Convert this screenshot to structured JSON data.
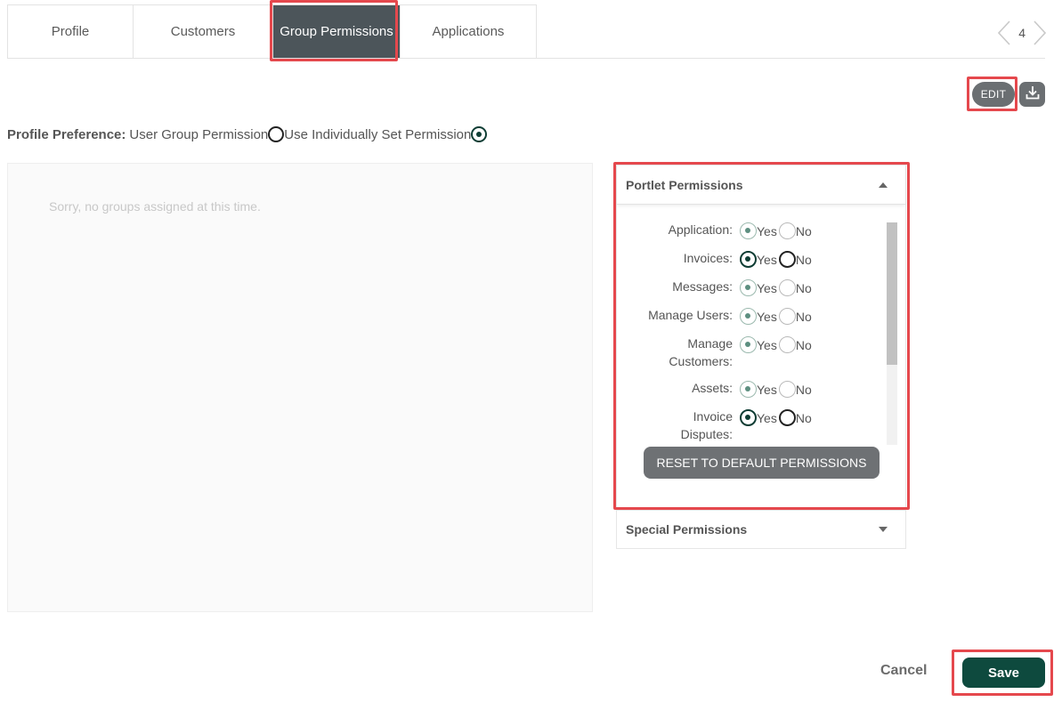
{
  "tabs": [
    {
      "label": "Profile"
    },
    {
      "label": "Customers"
    },
    {
      "label": "Group Permissions"
    },
    {
      "label": "Applications"
    }
  ],
  "pager": {
    "count": "4"
  },
  "toolbar": {
    "edit_label": "EDIT",
    "download_icon": "download-icon"
  },
  "preference": {
    "label": "Profile Preference:",
    "option_group": "User Group Permission",
    "option_individual": "Use Individually Set Permission",
    "selected": "individual"
  },
  "groups": {
    "empty_text": "Sorry, no groups assigned at this time."
  },
  "portlet": {
    "title": "Portlet Permissions",
    "yes_label": "Yes",
    "no_label": "No",
    "items": [
      {
        "label": "Application:",
        "value": "Yes"
      },
      {
        "label": "Invoices:",
        "value": "Yes"
      },
      {
        "label": "Messages:",
        "value": "Yes"
      },
      {
        "label": "Manage Users:",
        "value": "Yes"
      },
      {
        "label": "Manage Customers:",
        "value": "Yes"
      },
      {
        "label": "Assets:",
        "value": "Yes"
      },
      {
        "label": "Invoice Disputes:",
        "value": "Yes"
      }
    ],
    "reset_label": "RESET TO DEFAULT PERMISSIONS"
  },
  "special": {
    "title": "Special Permissions"
  },
  "footer": {
    "cancel_label": "Cancel",
    "save_label": "Save"
  },
  "colors": {
    "primary": "#0e4a3e",
    "tab_active": "#4c555a",
    "highlight": "#e5484d"
  }
}
